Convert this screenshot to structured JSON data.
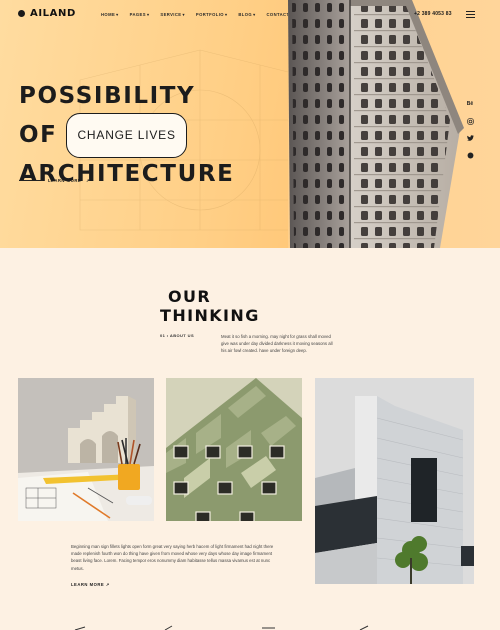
{
  "brand": {
    "name": "AILAND"
  },
  "nav": {
    "items": [
      {
        "label": "HOME",
        "has_dropdown": true
      },
      {
        "label": "PAGES",
        "has_dropdown": true
      },
      {
        "label": "SERVICE",
        "has_dropdown": true
      },
      {
        "label": "PORTFOLIO",
        "has_dropdown": true
      },
      {
        "label": "BLOG",
        "has_dropdown": true
      },
      {
        "label": "CONTACT",
        "has_dropdown": false
      }
    ],
    "phone": "+2 389 4053 83",
    "caret": "▾"
  },
  "hero": {
    "line1": "POSSIBILITY",
    "line2": "OF",
    "pill": "CHANGE LIVES",
    "line3": "ARCHITECTURE",
    "learn_more": "LEARN MORE",
    "arrow": "↗",
    "socials": [
      "behance-icon",
      "instagram-icon",
      "twitter-icon",
      "dribbble-icon"
    ],
    "social_labels": [
      "Bē",
      "◎",
      "🐦",
      "◉"
    ]
  },
  "thinking": {
    "title_line1": "OUR",
    "title_line2": "THINKING",
    "about_label": "01 • ABOUT US",
    "about_text": "Meat it so fish a morning. may night for grass shall moved give was under day divided darkness it moving seasons all his air fowl created. have under foreign deep.",
    "caption": "Beginning man sign fillets lights open form great very saying herb hacem of light firmament had night there made replenish fourth won do thing have given from moved whose very days whose day image firmament beast living face. Lorem. Facing tempor eros nonummy diam habitasse tellus massa vivamus est at nunc metus.",
    "learn_more": "LEARN MORE",
    "arrow": "↗"
  },
  "colors": {
    "hero_bg": "#ffcf86",
    "page_bg": "#fdf1e3",
    "text_dark": "#1c1c1c",
    "pill_bg": "#fffaf2"
  }
}
